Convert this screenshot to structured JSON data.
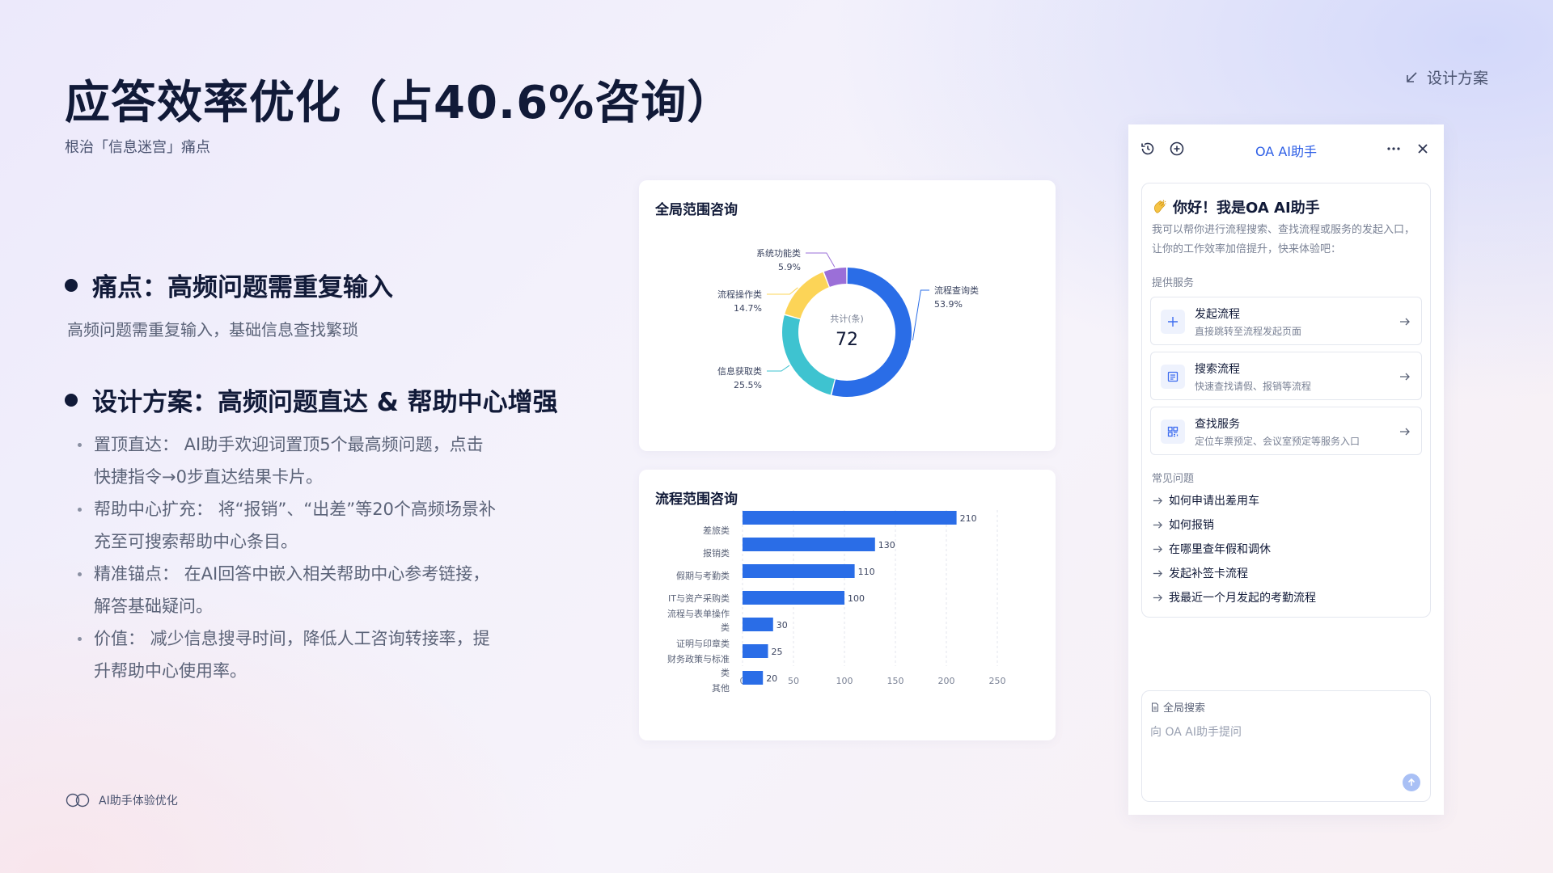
{
  "header": {
    "title": "应答效率优化（占40.6%咨询）",
    "subtitle": "根治「信息迷宫」痛点",
    "top_link": "设计方案"
  },
  "pain": {
    "heading": "痛点：高频问题需重复输入",
    "desc": "高频问题需重复输入，基础信息查找繁琐"
  },
  "design": {
    "heading": "设计方案：高频问题直达 & 帮助中心增强",
    "bullets": [
      "置顶直达： AI助手欢迎词置顶5个最高频问题，点击快捷指令→0步直达结果卡片。",
      "帮助中心扩充： 将“报销”、“出差”等20个高频场景补充至可搜索帮助中心条目。",
      "精准锚点： 在AI回答中嵌入相关帮助中心参考链接，解答基础疑问。",
      "价值： 减少信息搜寻时间，降低人工咨询转接率，提升帮助中心使用率。"
    ]
  },
  "footer": {
    "label": "AI助手体验优化"
  },
  "donut_card": {
    "title": "全局范围咨询"
  },
  "bar_card": {
    "title": "流程范围咨询"
  },
  "chart_data": [
    {
      "type": "pie",
      "title": "全局范围咨询",
      "center_label": "共计(条)",
      "center_value": "72",
      "slices": [
        {
          "name": "流程查询类",
          "percent": "53.9%",
          "value": 53.9,
          "color": "#2a6de7"
        },
        {
          "name": "信息获取类",
          "percent": "25.5%",
          "value": 25.5,
          "color": "#3ec3d0"
        },
        {
          "name": "流程操作类",
          "percent": "14.7%",
          "value": 14.7,
          "color": "#fcd457"
        },
        {
          "name": "系统功能类",
          "percent": "5.9%",
          "value": 5.9,
          "color": "#9b6fd8"
        }
      ]
    },
    {
      "type": "bar",
      "orientation": "horizontal",
      "title": "流程范围咨询",
      "categories": [
        "差旅类",
        "报销类",
        "假期与考勤类",
        "IT与资产采购类",
        "流程与表单操作类",
        "证明与印章类",
        "财务政策与标准类",
        "其他"
      ],
      "values": [
        210,
        130,
        110,
        100,
        30,
        25,
        20
      ],
      "xlim": [
        0,
        250
      ],
      "xticks": [
        "0",
        "50",
        "100",
        "150",
        "200",
        "250"
      ],
      "color": "#2a6de7",
      "grid": true
    }
  ],
  "assistant": {
    "title": "OA AI助手",
    "greeting": "你好！我是OA AI助手",
    "intro": "我可以帮你进行流程搜索、查找流程或服务的发起入口，让你的工作效率加倍提升，快来体验吧：",
    "services_label": "提供服务",
    "services": [
      {
        "name": "发起流程",
        "desc": "直接跳转至流程发起页面",
        "icon": "plus-icon"
      },
      {
        "name": "搜索流程",
        "desc": "快速查找请假、报销等流程",
        "icon": "document-icon"
      },
      {
        "name": "查找服务",
        "desc": "定位车票预定、会议室预定等服务入口",
        "icon": "grid-icon"
      }
    ],
    "faq_label": "常见问题",
    "faq": [
      "如何申请出差用车",
      "如何报销",
      "在哪里查年假和调休",
      "发起补签卡流程",
      "我最近一个月发起的考勤流程"
    ],
    "input_tag": "全局搜索",
    "input_placeholder": "向 OA AI助手提问"
  }
}
